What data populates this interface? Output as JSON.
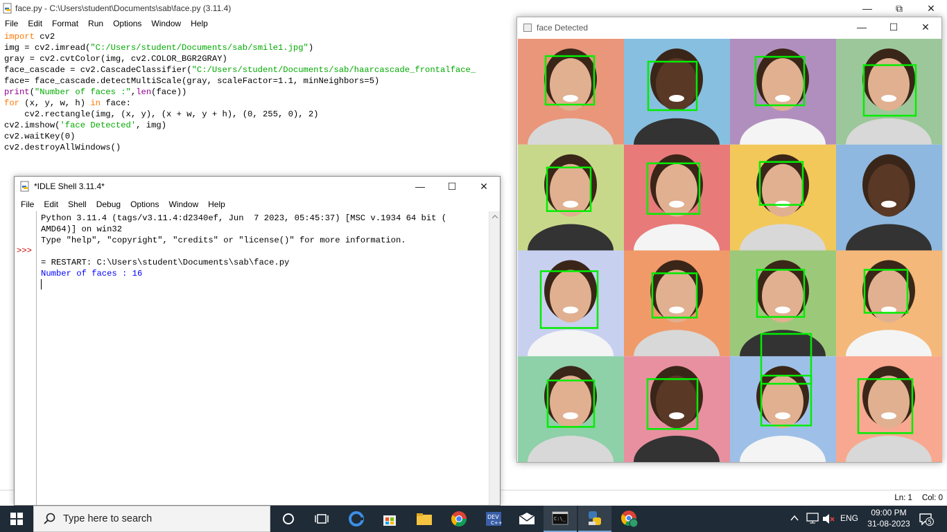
{
  "editor": {
    "title": "face.py - C:\\Users\\student\\Documents\\sab\\face.py (3.11.4)",
    "menu": [
      "File",
      "Edit",
      "Format",
      "Run",
      "Options",
      "Window",
      "Help"
    ],
    "code": [
      [
        {
          "t": "import",
          "c": "kw"
        },
        {
          "t": " cv2",
          "c": ""
        }
      ],
      [
        {
          "t": "img = cv2.imread(",
          "c": ""
        },
        {
          "t": "\"C:/Users/student/Documents/sab/smile1.jpg\"",
          "c": "str"
        },
        {
          "t": ")",
          "c": ""
        }
      ],
      [
        {
          "t": "gray = cv2.cvtColor(img, cv2.COLOR_BGR2GRAY)",
          "c": ""
        }
      ],
      [
        {
          "t": "face_cascade = cv2.CascadeClassifier(",
          "c": ""
        },
        {
          "t": "\"C:/Users/student/Documents/sab/haarcascade_frontalface_",
          "c": "str"
        }
      ],
      [
        {
          "t": "face= face_cascade.detectMultiScale(gray, scaleFactor=1.1, minNeighbors=5)",
          "c": ""
        }
      ],
      [
        {
          "t": "print",
          "c": "bi"
        },
        {
          "t": "(",
          "c": ""
        },
        {
          "t": "\"Number of faces :\"",
          "c": "str"
        },
        {
          "t": ",",
          "c": ""
        },
        {
          "t": "len",
          "c": "bi"
        },
        {
          "t": "(face))",
          "c": ""
        }
      ],
      [
        {
          "t": "for",
          "c": "kw"
        },
        {
          "t": " (x, y, w, h) ",
          "c": ""
        },
        {
          "t": "in",
          "c": "kw"
        },
        {
          "t": " face:",
          "c": ""
        }
      ],
      [
        {
          "t": "    cv2.rectangle(img, (x, y), (x + w, y + h), (0, 255, 0), 2)",
          "c": ""
        }
      ],
      [
        {
          "t": "cv2.imshow(",
          "c": ""
        },
        {
          "t": "'face Detected'",
          "c": "str"
        },
        {
          "t": ", img)",
          "c": ""
        }
      ],
      [
        {
          "t": "cv2.waitKey(0)",
          "c": ""
        }
      ],
      [
        {
          "t": "cv2.destroyAllWindows()",
          "c": ""
        }
      ]
    ],
    "status_line": "Ln: 1",
    "status_col": "Col: 0"
  },
  "shell": {
    "title": "*IDLE Shell 3.11.4*",
    "menu": [
      "File",
      "Edit",
      "Shell",
      "Debug",
      "Options",
      "Window",
      "Help"
    ],
    "prompt": ">>>",
    "lines": [
      {
        "t": "Python 3.11.4 (tags/v3.11.4:d2340ef, Jun  7 2023, 05:45:37) [MSC v.1934 64 bit (",
        "c": ""
      },
      {
        "t": "AMD64)] on win32",
        "c": ""
      },
      {
        "t": "Type \"help\", \"copyright\", \"credits\" or \"license()\" for more information.",
        "c": ""
      },
      {
        "t": "",
        "c": ""
      },
      {
        "t": "= RESTART: C:\\Users\\student\\Documents\\sab\\face.py",
        "c": ""
      },
      {
        "t": "Number of faces : 16",
        "c": "blue"
      }
    ]
  },
  "face_window": {
    "title": "face Detected",
    "tile_colors": [
      "#e9967a",
      "#87bfe0",
      "#b08fbf",
      "#9cc79a",
      "#c8d88a",
      "#e87a7a",
      "#f2c85a",
      "#8eb8e0",
      "#c8d0f0",
      "#f09a6a",
      "#9cc87a",
      "#f4b87a",
      "#8ed0a8",
      "#e890a0",
      "#9ec0e8",
      "#f8a890"
    ],
    "detection_color": "#00ee00",
    "face_count": 16
  },
  "taskbar": {
    "search_placeholder": "Type here to search",
    "language": "ENG",
    "time": "09:00 PM",
    "date": "31-08-2023",
    "notification_count": "5"
  }
}
